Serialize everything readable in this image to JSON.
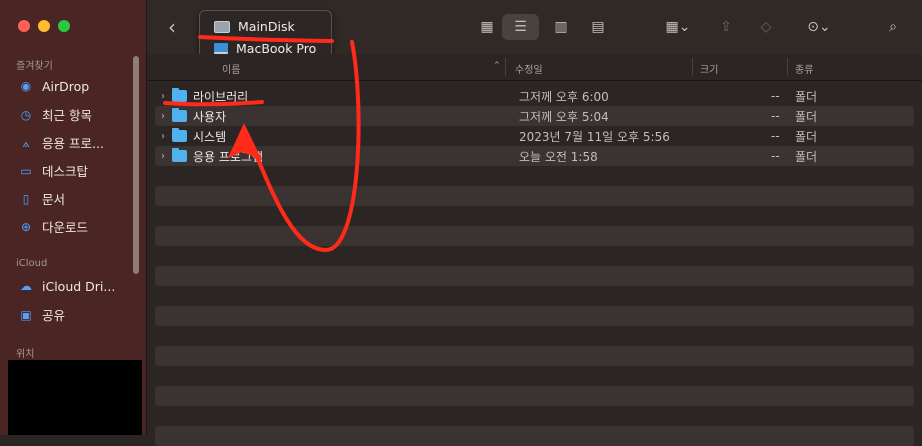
{
  "sidebar": {
    "section_favorites": "즐겨찾기",
    "favorites": [
      {
        "label": "AirDrop",
        "icon": "airdrop-icon"
      },
      {
        "label": "최근 항목",
        "icon": "clock-icon"
      },
      {
        "label": "응용 프로...",
        "icon": "apps-icon"
      },
      {
        "label": "데스크탑",
        "icon": "desktop-icon"
      },
      {
        "label": "문서",
        "icon": "document-icon"
      },
      {
        "label": "다운로드",
        "icon": "download-icon"
      }
    ],
    "section_icloud": "iCloud",
    "icloud": [
      {
        "label": "iCloud Dri...",
        "icon": "cloud-icon"
      },
      {
        "label": "공유",
        "icon": "shared-folder-icon"
      }
    ],
    "section_locations": "위치"
  },
  "path_popup": {
    "items": [
      "MainDisk",
      "MacBook Pro"
    ]
  },
  "columns": {
    "name": "이름",
    "modified": "수정일",
    "size": "크기",
    "kind": "종류"
  },
  "files": [
    {
      "name": "라이브러리",
      "modified": "그저께 오후 6:00",
      "size": "--",
      "kind": "폴더"
    },
    {
      "name": "사용자",
      "modified": "그저께 오후 5:04",
      "size": "--",
      "kind": "폴더"
    },
    {
      "name": "시스템",
      "modified": "2023년 7월 11일 오후 5:56",
      "size": "--",
      "kind": "폴더"
    },
    {
      "name": "응용 프로그램",
      "modified": "오늘 오전 1:58",
      "size": "--",
      "kind": "폴더"
    }
  ],
  "colors": {
    "sidebar_bg": "#4a2523",
    "accent": "#4da3ff",
    "annotation": "#ff2a1a"
  }
}
